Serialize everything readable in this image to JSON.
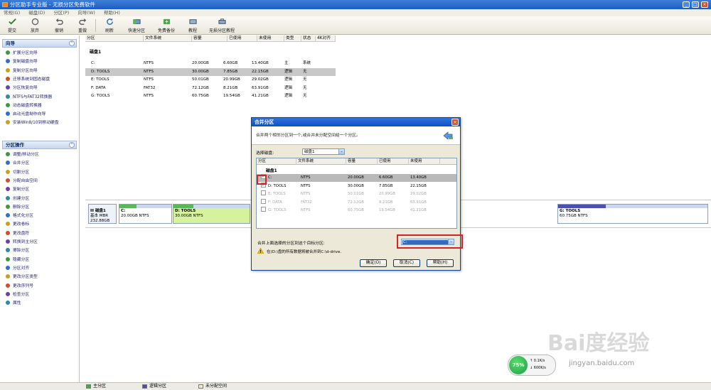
{
  "window": {
    "title": "分区助手专业版 - 无损分区免费软件",
    "min": "_",
    "max": "□",
    "close": "×"
  },
  "menu": [
    "常规(G)",
    "磁盘(D)",
    "分区(P)",
    "向导(W)",
    "帮助(H)"
  ],
  "toolbar": [
    {
      "label": "提交",
      "icon": "commit-icon"
    },
    {
      "label": "放弃",
      "icon": "discard-icon"
    },
    {
      "label": "撤销",
      "icon": "undo-icon"
    },
    {
      "label": "重做",
      "icon": "redo-icon"
    },
    {
      "label": "刷新",
      "icon": "refresh-icon"
    },
    {
      "label": "快速分区",
      "icon": "quick-partition-icon"
    },
    {
      "label": "免费备份",
      "icon": "backup-icon"
    },
    {
      "label": "教程",
      "icon": "tutorial-icon"
    },
    {
      "label": "无损分区教程",
      "icon": "lossless-tutorial-icon"
    }
  ],
  "sidebar": {
    "wizard_title": "向导",
    "wizard_items": [
      "扩展分区向导",
      "复制磁盘向导",
      "复制分区向导",
      "迁移系统到固态磁盘",
      "分区恢复向导",
      "NTFS与FAT32转换器",
      "动态磁盘转换器",
      "启动光盘制作向导",
      "安装Win8/10到移动硬盘"
    ],
    "ops_title": "分区操作",
    "ops_items": [
      "调整/移动分区",
      "合并分区",
      "切割分区",
      "分配自由空间",
      "复制分区",
      "创建分区",
      "删除分区",
      "格式化分区",
      "更改卷标",
      "更改盘符",
      "转换到主分区",
      "擦除分区",
      "隐藏分区",
      "分区对齐",
      "更改分区类型",
      "更改序列号",
      "检查分区",
      "属性"
    ],
    "colors": [
      "#3a9a3a",
      "#2f6fd1",
      "#c8a020",
      "#d44a2a",
      "#6a3fb0",
      "#2a8aa8"
    ]
  },
  "partition_table": {
    "columns": [
      "分区",
      "文件系统",
      "容量",
      "已使用",
      "未使用",
      "类型",
      "状态",
      "4K对齐"
    ],
    "disk_label": "磁盘1",
    "rows": [
      {
        "name": "C:",
        "fs": "NTFS",
        "cap": "20.00GB",
        "used": "6.60GB",
        "free": "13.40GB",
        "type": "主",
        "status": "系统"
      },
      {
        "name": "D: TOOLS",
        "fs": "NTFS",
        "cap": "30.00GB",
        "used": "7.85GB",
        "free": "22.15GB",
        "type": "逻辑",
        "status": "无"
      },
      {
        "name": "E: TOOLS",
        "fs": "NTFS",
        "cap": "50.01GB",
        "used": "20.99GB",
        "free": "29.02GB",
        "type": "逻辑",
        "status": "无"
      },
      {
        "name": "F: DATA",
        "fs": "FAT32",
        "cap": "72.12GB",
        "used": "8.21GB",
        "free": "63.91GB",
        "type": "逻辑",
        "status": "无"
      },
      {
        "name": "G: TOOLS",
        "fs": "NTFS",
        "cap": "60.75GB",
        "used": "19.54GB",
        "free": "41.21GB",
        "type": "逻辑",
        "status": "无"
      }
    ]
  },
  "diskmap": {
    "disk": {
      "name": "磁盘1",
      "type": "基本 MBR",
      "size": "232.88GB"
    },
    "blocks": [
      {
        "name": "C:",
        "info": "20.00GB NTFS",
        "bar": "#58b858",
        "used": 0.33
      },
      {
        "name": "D: TOOLS",
        "info": "30.00GB NTFS",
        "bar": "#58b858",
        "used": 0.26
      },
      {
        "name": "G: TOOLS",
        "info": "60.75GB NTFS",
        "bar": "#4a50b0",
        "used": 0.32
      }
    ]
  },
  "statusbar": {
    "legend": [
      "主分区",
      "逻辑分区",
      "未分配空间"
    ],
    "colors": [
      "#4aa84a",
      "#4a50b0",
      "#f4e8c8"
    ]
  },
  "dialog": {
    "title": "合并分区",
    "close": "×",
    "description": "合并两个相邻分区到一个,或合并未分配空间给一个分区。",
    "select_disk_label": "选择磁盘:",
    "select_disk_value": "磁盘1",
    "list_columns": [
      "分区",
      "文件系统",
      "容量",
      "已使用",
      "未使用"
    ],
    "disk_label": "磁盘1",
    "rows": [
      {
        "name": "C:",
        "fs": "NTFS",
        "cap": "20.00GB",
        "used": "6.60GB",
        "free": "13.40GB",
        "checked": true,
        "enabled": true,
        "selected": true
      },
      {
        "name": "D: TOOLS",
        "fs": "NTFS",
        "cap": "30.00GB",
        "used": "7.85GB",
        "free": "22.15GB",
        "checked": true,
        "enabled": true,
        "selected": false
      },
      {
        "name": "E: TOOLS",
        "fs": "NTFS",
        "cap": "50.01GB",
        "used": "20.99GB",
        "free": "29.02GB",
        "checked": false,
        "enabled": false,
        "selected": false
      },
      {
        "name": "F: DATA",
        "fs": "FAT32",
        "cap": "72.12GB",
        "used": "8.21GB",
        "free": "63.91GB",
        "checked": false,
        "enabled": false,
        "selected": false
      },
      {
        "name": "G: TOOLS",
        "fs": "NTFS",
        "cap": "60.75GB",
        "used": "19.54GB",
        "free": "41.21GB",
        "checked": false,
        "enabled": false,
        "selected": false
      }
    ],
    "merge_target_label": "合并上面选择的分区到这个目标分区:",
    "merge_target_value": "C:",
    "warning_text": "在(D:)盘的所有数据将被合并到C:\\d-drive.",
    "buttons": {
      "ok": "确定(O)",
      "cancel": "取消(C)",
      "help": "帮助(H)"
    }
  },
  "netwidget": {
    "percent": "75%",
    "up": "0.1K/s",
    "down": "600K/s"
  },
  "watermark": {
    "text": "Bai度经验",
    "url": "jingyan.baidu.com"
  }
}
